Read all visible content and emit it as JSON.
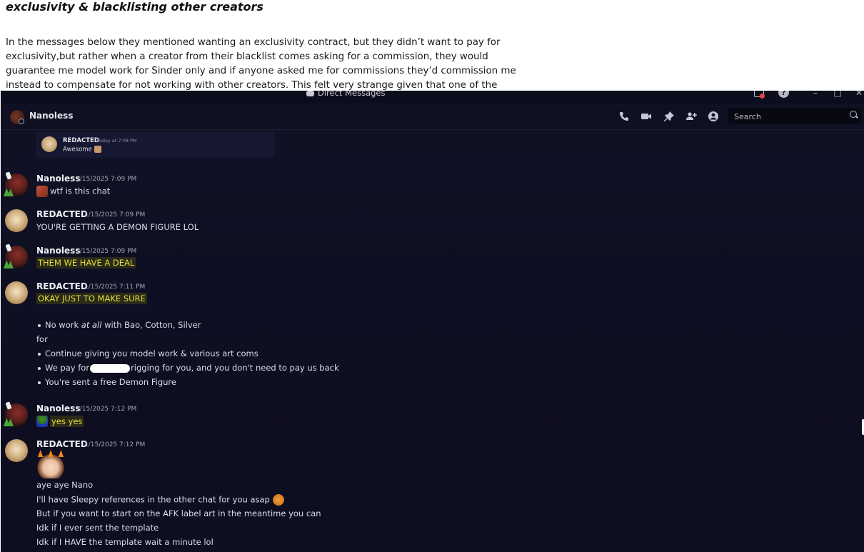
{
  "doc": {
    "title": "exclusivity & blacklisting other creators",
    "paragraph_lines": [
      "In the messages below they mentioned wanting an exclusivity contract, but they didn’t want to pay for",
      "exclusivity,but rather when a creator from their blacklist comes asking for a commission, they would",
      "guarantee me model work for Sinder only and if anyone asked me for commissions they’d commission me",
      "instead to compensate for not working with other creators. This felt very strange given that one of the"
    ]
  },
  "window": {
    "title": "Direct Messages",
    "controls": {
      "minimize": "–",
      "maximize": "□",
      "close": "✕"
    },
    "help": "?"
  },
  "header": {
    "dm_name": "Nanoless",
    "search_placeholder": "Search",
    "icons": [
      "voice-call-icon",
      "video-call-icon",
      "pinned-messages-icon",
      "add-friends-icon",
      "user-profile-icon"
    ]
  },
  "reply_preview": {
    "author": "REDACTED",
    "timestamp": "Today at 7:08 PM",
    "text": "Awesome"
  },
  "messages": [
    {
      "author": "Nanoless",
      "timestamp": "1/15/2025 7:09 PM",
      "text": "wtf is this chat"
    },
    {
      "author": "REDACTED",
      "timestamp": "1/15/2025 7:09 PM",
      "text": "YOU'RE GETTING A DEMON FIGURE LOL"
    },
    {
      "author": "Nanoless",
      "timestamp": "1/15/2025 7:09 PM",
      "text": "THEM WE HAVE A DEAL"
    },
    {
      "author": "REDACTED",
      "timestamp": "1/15/2025 7:11 PM",
      "text": "OKAY JUST TO MAKE SURE",
      "bullet1_pre": "No work ",
      "bullet1_em": "at all",
      "bullet1_post": " with Bao, Cotton, Silver",
      "for": "for",
      "bullet2": "Continue giving you model work & various art coms",
      "bullet3_pre": "We pay for",
      "bullet3_post": "rigging for you, and you don't need to pay us back",
      "bullet4": "You're sent a free Demon Figure"
    },
    {
      "author": "Nanoless",
      "timestamp": "1/15/2025 7:12 PM",
      "text": "yes yes"
    },
    {
      "author": "REDACTED",
      "timestamp": "1/15/2025 7:12 PM",
      "lines": [
        "aye aye Nano",
        "I'll have Sleepy references in the other chat for you asap",
        "But if you want to start on the AFK label art in the meantime you can",
        "Idk if I ever sent the template",
        "Idk if I HAVE the template wait a minute lol"
      ]
    }
  ]
}
